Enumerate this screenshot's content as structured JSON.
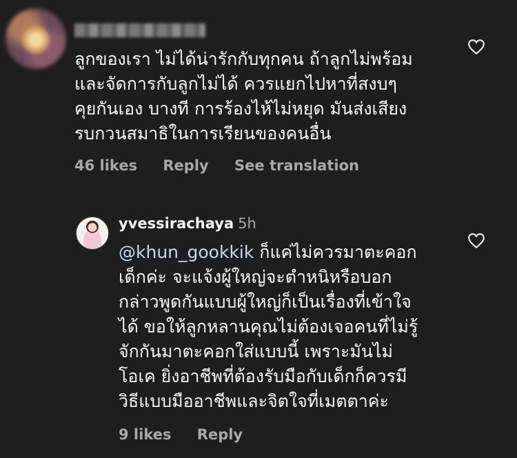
{
  "comment": {
    "lines": [
      "ลูกของเรา ไม่ได้น่ารักกับทุกคน ถ้าลูกไม่พร้อม",
      "และจัดการกับลูกไม่ได้ ควรแยกไปหาที่สงบๆ",
      "คุยกันเอง บางที การร้องไห้ไม่หยุด มันส่งเสียง",
      "รบกวนสมาธิในการเรียนของคนอื่น"
    ],
    "likes": "46 likes",
    "reply": "Reply",
    "translate": "See translation"
  },
  "reply_comment": {
    "username": "yvessirachaya",
    "time": "5h",
    "mention": "@khun_gookkik",
    "first_line_rest": " ก็แค่ไม่ควรมาตะคอก",
    "lines": [
      "เด็กค่ะ จะแจ้งผู้ใหญ่จะตำหนิหรือบอก",
      "กล่าวพูดกันแบบผู้ใหญ่ก็เป็นเรื่องที่เข้าใจ",
      "ได้ ขอให้ลูกหลานคุณไม่ต้องเจอคนที่ไม่รู้",
      "จักกันมาตะคอกใส่แบบนี้ เพราะมันไม่",
      "โอเค ยิ่งอาชีพที่ต้องรับมือกับเด็กก็ควรมี",
      "วิธีแบบมืออาชีพและจิตใจที่เมตตาค่ะ"
    ],
    "likes": "9 likes",
    "reply": "Reply"
  },
  "icons": {
    "heart": "heart-outline-icon"
  }
}
